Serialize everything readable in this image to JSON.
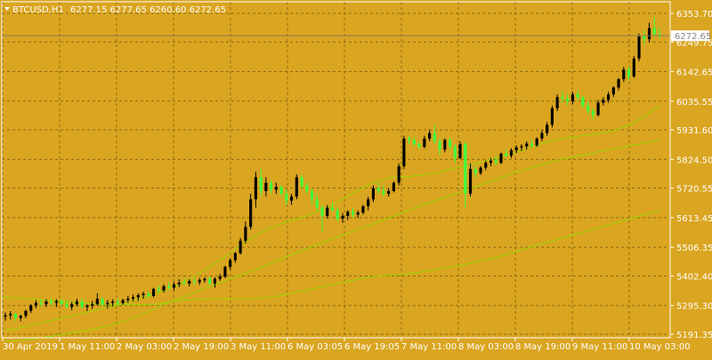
{
  "header": {
    "symbol": "BTCUSD,H1",
    "ohlc": "6277.15 6277.65 6260.60 6272.65"
  },
  "colors": {
    "background": "#daa520",
    "grid": "#8a6a10",
    "axis_text": "#ffffff",
    "bull_candle": "#000000",
    "bear_candle": "#3dff3d",
    "ma_color": "#9ad800",
    "price_line": "#8a7a60",
    "price_label_bg": "#ffffff",
    "price_label_text": "#888888"
  },
  "chart_data": {
    "type": "candlestick",
    "title": "BTCUSD,H1",
    "ylim": [
      5191.35,
      6353.7
    ],
    "y_ticks": [
      "6353.70",
      "6249.75",
      "6142.65",
      "6035.55",
      "5931.60",
      "5824.50",
      "5720.55",
      "5613.45",
      "5506.35",
      "5402.40",
      "5295.30",
      "5191.35"
    ],
    "x_ticks": [
      "30 Apr 2019",
      "1 May 11:00",
      "2 May 03:00",
      "2 May 19:00",
      "3 May 11:00",
      "6 May 03:05",
      "6 May 19:05",
      "7 May 11:00",
      "8 May 03:00",
      "8 May 19:00",
      "9 May 11:00",
      "10 May 03:00"
    ],
    "current_price": "6272.65",
    "candles": [
      [
        5255,
        5270,
        5240,
        5260
      ],
      [
        5260,
        5275,
        5245,
        5265
      ],
      [
        5265,
        5268,
        5240,
        5250
      ],
      [
        5250,
        5262,
        5238,
        5258
      ],
      [
        5258,
        5280,
        5250,
        5276
      ],
      [
        5276,
        5300,
        5268,
        5296
      ],
      [
        5296,
        5315,
        5285,
        5305
      ],
      [
        5305,
        5320,
        5290,
        5300
      ],
      [
        5300,
        5318,
        5290,
        5310
      ],
      [
        5310,
        5322,
        5295,
        5305
      ],
      [
        5305,
        5318,
        5290,
        5312
      ],
      [
        5312,
        5320,
        5296,
        5300
      ],
      [
        5300,
        5315,
        5285,
        5290
      ],
      [
        5290,
        5308,
        5278,
        5300
      ],
      [
        5300,
        5320,
        5292,
        5310
      ],
      [
        5310,
        5320,
        5285,
        5290
      ],
      [
        5290,
        5300,
        5275,
        5295
      ],
      [
        5295,
        5312,
        5283,
        5300
      ],
      [
        5300,
        5340,
        5295,
        5320
      ],
      [
        5320,
        5325,
        5295,
        5300
      ],
      [
        5300,
        5315,
        5285,
        5305
      ],
      [
        5305,
        5318,
        5292,
        5310
      ],
      [
        5310,
        5322,
        5298,
        5304
      ],
      [
        5304,
        5320,
        5298,
        5315
      ],
      [
        5315,
        5330,
        5305,
        5320
      ],
      [
        5320,
        5335,
        5310,
        5325
      ],
      [
        5325,
        5340,
        5312,
        5333
      ],
      [
        5333,
        5345,
        5320,
        5338
      ],
      [
        5338,
        5348,
        5325,
        5330
      ],
      [
        5330,
        5360,
        5325,
        5355
      ],
      [
        5355,
        5370,
        5345,
        5350
      ],
      [
        5350,
        5372,
        5342,
        5365
      ],
      [
        5365,
        5380,
        5355,
        5360
      ],
      [
        5360,
        5380,
        5350,
        5372
      ],
      [
        5372,
        5390,
        5362,
        5378
      ],
      [
        5378,
        5393,
        5368,
        5375
      ],
      [
        5375,
        5390,
        5365,
        5384
      ],
      [
        5384,
        5395,
        5372,
        5380
      ],
      [
        5380,
        5395,
        5370,
        5387
      ],
      [
        5387,
        5398,
        5378,
        5392
      ],
      [
        5392,
        5400,
        5370,
        5375
      ],
      [
        5375,
        5398,
        5360,
        5392
      ],
      [
        5392,
        5410,
        5385,
        5400
      ],
      [
        5400,
        5440,
        5395,
        5435
      ],
      [
        5435,
        5465,
        5425,
        5460
      ],
      [
        5460,
        5490,
        5450,
        5485
      ],
      [
        5485,
        5540,
        5480,
        5530
      ],
      [
        5530,
        5600,
        5520,
        5580
      ],
      [
        5580,
        5700,
        5570,
        5680
      ],
      [
        5680,
        5780,
        5650,
        5760
      ],
      [
        5760,
        5790,
        5690,
        5710
      ],
      [
        5710,
        5760,
        5690,
        5740
      ],
      [
        5740,
        5750,
        5700,
        5715
      ],
      [
        5715,
        5740,
        5700,
        5725
      ],
      [
        5725,
        5730,
        5690,
        5700
      ],
      [
        5700,
        5715,
        5660,
        5675
      ],
      [
        5675,
        5700,
        5660,
        5690
      ],
      [
        5690,
        5770,
        5680,
        5760
      ],
      [
        5760,
        5770,
        5720,
        5730
      ],
      [
        5730,
        5740,
        5700,
        5710
      ],
      [
        5710,
        5720,
        5660,
        5680
      ],
      [
        5680,
        5700,
        5640,
        5650
      ],
      [
        5650,
        5660,
        5560,
        5620
      ],
      [
        5620,
        5660,
        5610,
        5650
      ],
      [
        5650,
        5668,
        5635,
        5640
      ],
      [
        5640,
        5650,
        5600,
        5610
      ],
      [
        5610,
        5630,
        5595,
        5620
      ],
      [
        5620,
        5640,
        5605,
        5635
      ],
      [
        5635,
        5650,
        5615,
        5625
      ],
      [
        5625,
        5640,
        5612,
        5632
      ],
      [
        5632,
        5660,
        5625,
        5655
      ],
      [
        5655,
        5690,
        5640,
        5680
      ],
      [
        5680,
        5730,
        5670,
        5720
      ],
      [
        5720,
        5740,
        5700,
        5710
      ],
      [
        5710,
        5730,
        5690,
        5700
      ],
      [
        5700,
        5720,
        5690,
        5710
      ],
      [
        5710,
        5745,
        5705,
        5740
      ],
      [
        5740,
        5810,
        5730,
        5800
      ],
      [
        5800,
        5910,
        5790,
        5900
      ],
      [
        5900,
        5910,
        5880,
        5895
      ],
      [
        5895,
        5905,
        5870,
        5880
      ],
      [
        5880,
        5890,
        5860,
        5870
      ],
      [
        5870,
        5910,
        5865,
        5900
      ],
      [
        5900,
        5930,
        5890,
        5920
      ],
      [
        5920,
        5950,
        5880,
        5890
      ],
      [
        5890,
        5900,
        5840,
        5860
      ],
      [
        5860,
        5900,
        5850,
        5895
      ],
      [
        5895,
        5905,
        5860,
        5870
      ],
      [
        5870,
        5880,
        5810,
        5830
      ],
      [
        5830,
        5890,
        5825,
        5880
      ],
      [
        5880,
        5890,
        5650,
        5700
      ],
      [
        5700,
        5810,
        5690,
        5790
      ],
      [
        5790,
        5800,
        5760,
        5775
      ],
      [
        5775,
        5800,
        5768,
        5795
      ],
      [
        5795,
        5820,
        5785,
        5812
      ],
      [
        5812,
        5830,
        5800,
        5820
      ],
      [
        5820,
        5835,
        5805,
        5812
      ],
      [
        5812,
        5850,
        5808,
        5845
      ],
      [
        5845,
        5860,
        5832,
        5838
      ],
      [
        5838,
        5865,
        5830,
        5858
      ],
      [
        5858,
        5875,
        5848,
        5868
      ],
      [
        5868,
        5880,
        5855,
        5872
      ],
      [
        5872,
        5890,
        5860,
        5882
      ],
      [
        5882,
        5895,
        5868,
        5875
      ],
      [
        5875,
        5905,
        5870,
        5900
      ],
      [
        5900,
        5930,
        5890,
        5920
      ],
      [
        5920,
        5960,
        5910,
        5950
      ],
      [
        5950,
        6020,
        5940,
        6010
      ],
      [
        6010,
        6060,
        6000,
        6050
      ],
      [
        6050,
        6070,
        6030,
        6045
      ],
      [
        6045,
        6060,
        6020,
        6035
      ],
      [
        6035,
        6070,
        6025,
        6060
      ],
      [
        6060,
        6075,
        6040,
        6050
      ],
      [
        6050,
        6055,
        6010,
        6020
      ],
      [
        6020,
        6035,
        5990,
        6000
      ],
      [
        6000,
        6010,
        5970,
        5985
      ],
      [
        5985,
        6040,
        5980,
        6030
      ],
      [
        6030,
        6050,
        6020,
        6040
      ],
      [
        6040,
        6070,
        6030,
        6060
      ],
      [
        6060,
        6090,
        6050,
        6085
      ],
      [
        6085,
        6120,
        6075,
        6115
      ],
      [
        6115,
        6160,
        6105,
        6150
      ],
      [
        6150,
        6160,
        6110,
        6125
      ],
      [
        6125,
        6200,
        6120,
        6190
      ],
      [
        6190,
        6280,
        6180,
        6270
      ],
      [
        6270,
        6290,
        6240,
        6260
      ],
      [
        6260,
        6320,
        6250,
        6300
      ],
      [
        6300,
        6340,
        6270,
        6278
      ],
      [
        6278,
        6300,
        6262,
        6272
      ]
    ],
    "moving_averages": [
      {
        "period": "fast",
        "values": [
          5205,
          5215,
          5226,
          5240,
          5252,
          5265,
          5278,
          5290,
          5302,
          5318,
          5335,
          5355,
          5380,
          5410,
          5445,
          5480,
          5520,
          5555,
          5580,
          5600,
          5615,
          5635,
          5660,
          5690,
          5720,
          5745,
          5760,
          5762,
          5768,
          5775,
          5790,
          5800,
          5815,
          5830,
          5845,
          5860,
          5880,
          5895,
          5905,
          5912,
          5918,
          5930,
          5950,
          5980,
          6020
        ]
      },
      {
        "period": "medium",
        "values": [
          5165,
          5170,
          5178,
          5188,
          5198,
          5210,
          5225,
          5245,
          5270,
          5300,
          5325,
          5350,
          5375,
          5398,
          5422,
          5448,
          5475,
          5500,
          5525,
          5550,
          5572,
          5595,
          5620,
          5645,
          5668,
          5690,
          5712,
          5735,
          5758,
          5780,
          5800,
          5818,
          5832,
          5845,
          5858,
          5870,
          5882,
          5895
        ]
      },
      {
        "period": "slow",
        "values": [
          5325,
          5322,
          5316,
          5310,
          5305,
          5300,
          5300,
          5298,
          5300,
          5312,
          5318,
          5320,
          5320,
          5320,
          5325,
          5340,
          5355,
          5370,
          5385,
          5398,
          5405,
          5410,
          5420,
          5432,
          5445,
          5460,
          5478,
          5500,
          5520,
          5540,
          5560,
          5580,
          5600,
          5620,
          5640
        ]
      }
    ]
  }
}
